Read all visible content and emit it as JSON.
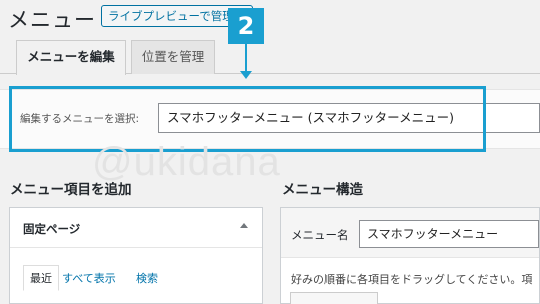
{
  "page": {
    "title": "メニュー",
    "live_preview_label": "ライブプレビューで管理"
  },
  "tabs": [
    {
      "label": "メニューを編集"
    },
    {
      "label": "位置を管理"
    }
  ],
  "annotation": {
    "step_number": "2",
    "color": "#1a9fd0"
  },
  "menu_selector": {
    "label": "編集するメニューを選択:",
    "selected_value": "スマホフッターメニュー (スマホフッターメニュー)"
  },
  "watermark": "@ukidana",
  "add_items": {
    "title": "メニュー項目を追加",
    "panel_title": "固定ページ",
    "sub_tabs": [
      "最近",
      "すべて表示",
      "検索"
    ]
  },
  "menu_structure": {
    "title": "メニュー構造",
    "name_label": "メニュー名",
    "name_value": "スマホフッターメニュー",
    "instructions": "好みの順番に各項目をドラッグしてください。項"
  }
}
